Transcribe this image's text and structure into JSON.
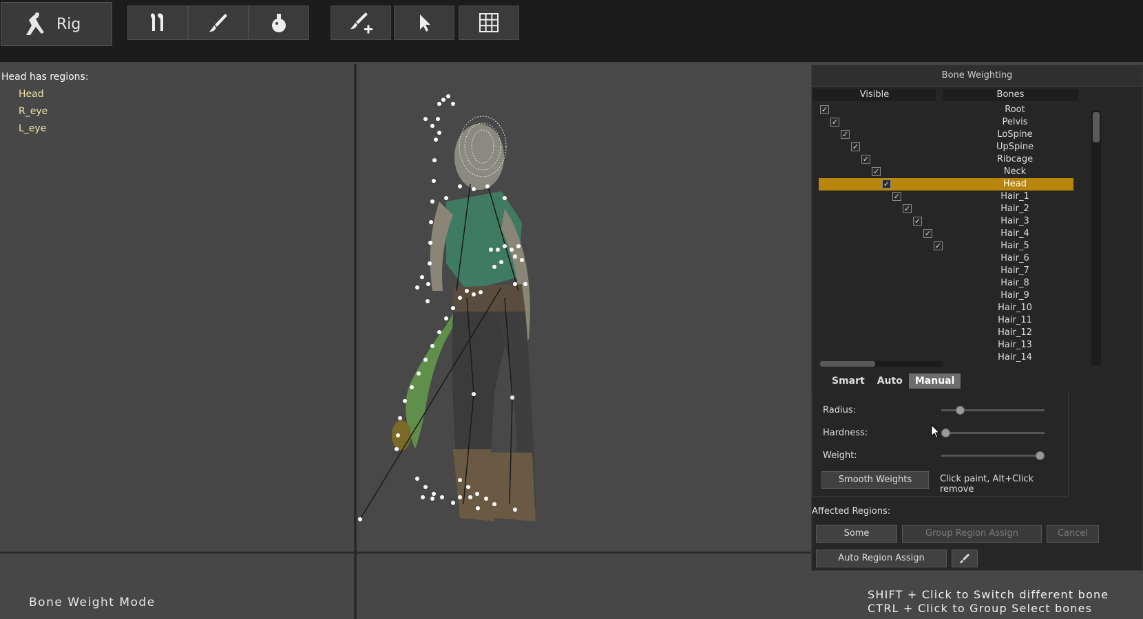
{
  "toolbar": {
    "mode_label": "Rig",
    "icons": [
      "rig-figure-icon",
      "bones-icon",
      "brush-icon",
      "flask-icon",
      "add-brush-icon",
      "pointer-icon",
      "grid-icon"
    ]
  },
  "regions": {
    "title": "Head has regions:",
    "items": [
      "Head",
      "R_eye",
      "L_eye"
    ]
  },
  "status": {
    "mode": "Bone Weight Mode",
    "hint_1": "SHIFT + Click to Switch different bone",
    "hint_2": "CTRL + Click to Group Select bones"
  },
  "bone_panel": {
    "title": "Bone Weighting",
    "col_visible": "Visible",
    "col_bones": "Bones",
    "bones": [
      {
        "name": "Root",
        "depth": 0,
        "checked": true
      },
      {
        "name": "Pelvis",
        "depth": 1,
        "checked": true
      },
      {
        "name": "LoSpine",
        "depth": 2,
        "checked": true
      },
      {
        "name": "UpSpine",
        "depth": 3,
        "checked": true
      },
      {
        "name": "Ribcage",
        "depth": 4,
        "checked": true
      },
      {
        "name": "Neck",
        "depth": 5,
        "checked": true
      },
      {
        "name": "Head",
        "depth": 6,
        "checked": true,
        "selected": true
      },
      {
        "name": "Hair_1",
        "depth": 7,
        "checked": true
      },
      {
        "name": "Hair_2",
        "depth": 8,
        "checked": true
      },
      {
        "name": "Hair_3",
        "depth": 9,
        "checked": true
      },
      {
        "name": "Hair_4",
        "depth": 10,
        "checked": true
      },
      {
        "name": "Hair_5",
        "depth": 11,
        "checked": true
      },
      {
        "name": "Hair_6"
      },
      {
        "name": "Hair_7"
      },
      {
        "name": "Hair_8"
      },
      {
        "name": "Hair_9"
      },
      {
        "name": "Hair_10"
      },
      {
        "name": "Hair_11"
      },
      {
        "name": "Hair_12"
      },
      {
        "name": "Hair_13"
      },
      {
        "name": "Hair_14"
      }
    ],
    "tabs": [
      "Smart",
      "Auto",
      "Manual"
    ],
    "active_tab": "Manual",
    "radius_label": "Radius:",
    "hardness_label": "Hardness:",
    "weight_label": "Weight:",
    "radius_value": 0.15,
    "hardness_value": 0.0,
    "weight_value": 1.0,
    "smooth_btn": "Smooth Weights",
    "paint_hint": "Click paint, Alt+Click remove",
    "affected_label": "Affected Regions:",
    "some_btn": "Some",
    "group_assign_btn": "Group Region Assign",
    "cancel_btn": "Cancel",
    "auto_assign_btn": "Auto Region Assign"
  },
  "colors": {
    "selected_row": "#b8860b",
    "accent": "#b8860b"
  }
}
